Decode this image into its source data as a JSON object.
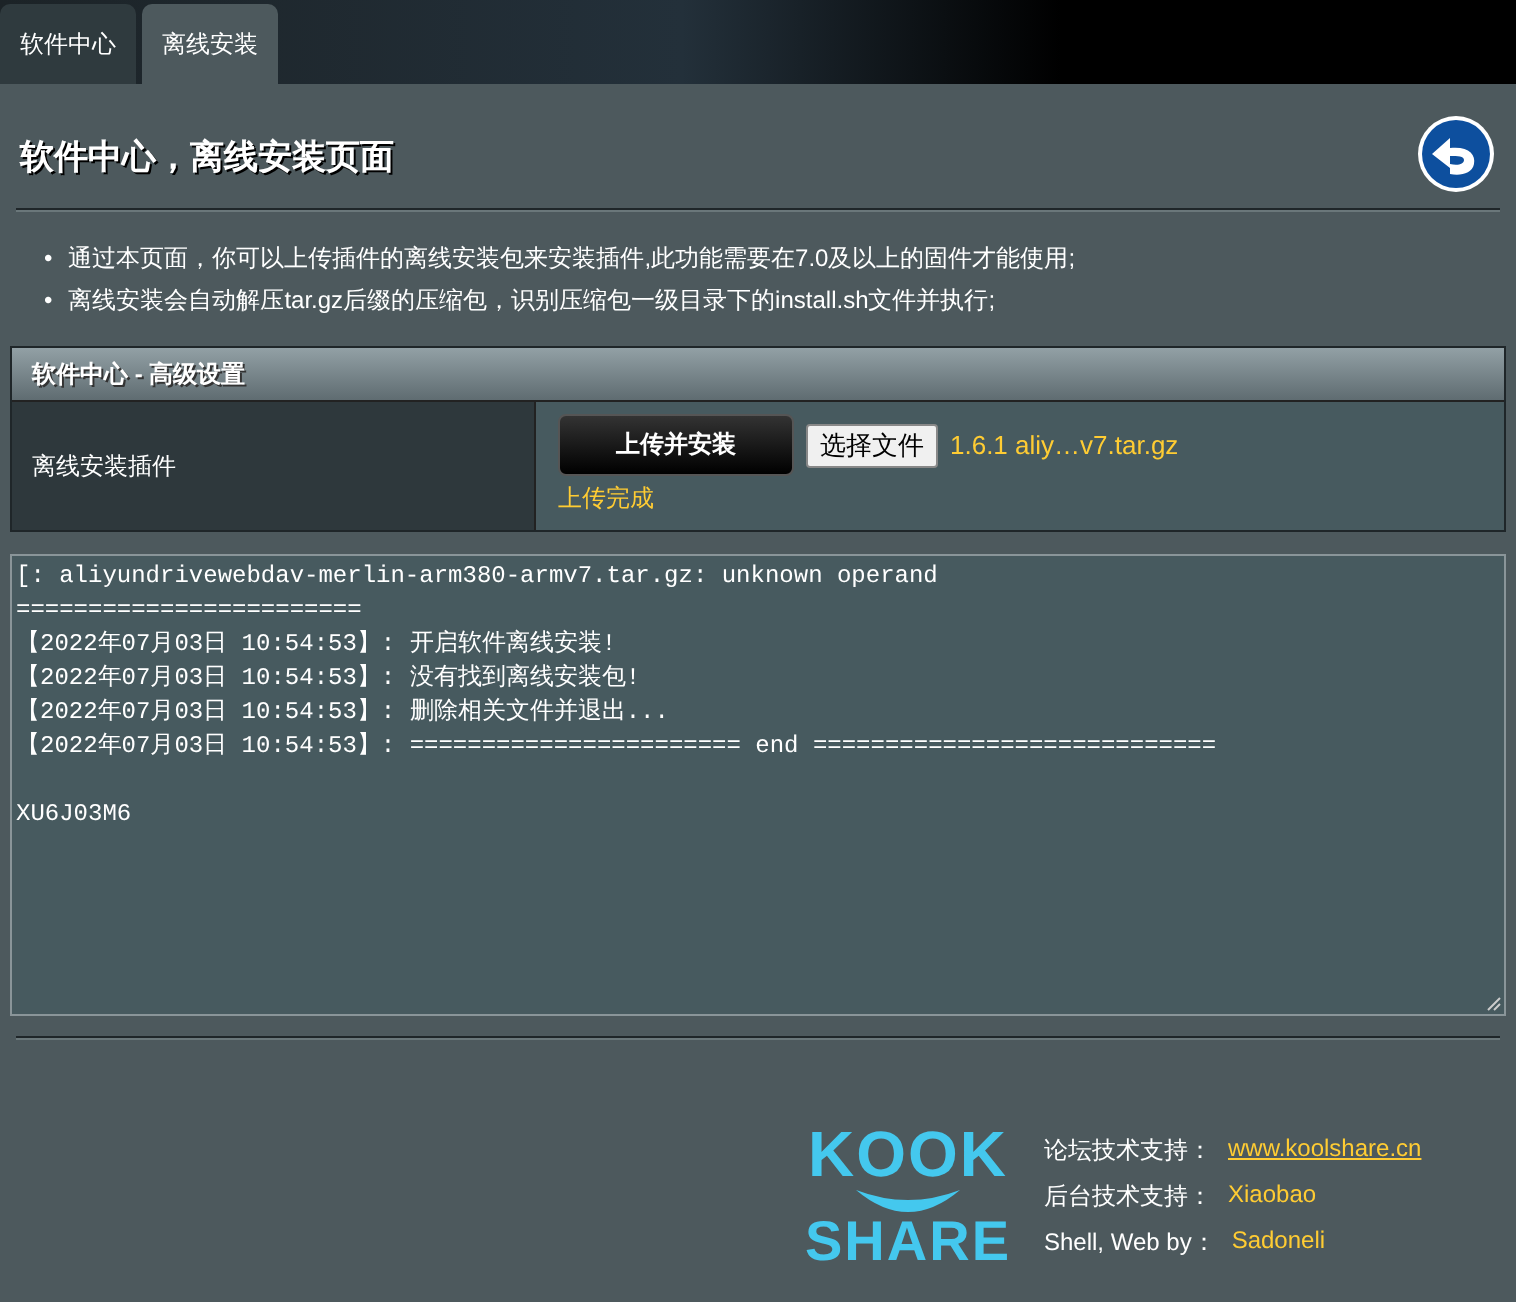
{
  "tabs": [
    {
      "label": "软件中心",
      "selected": false
    },
    {
      "label": "离线安装",
      "selected": true
    }
  ],
  "page": {
    "title": "软件中心，离线安装页面"
  },
  "notes": [
    {
      "marker": "•",
      "text": "通过本页面，你可以上传插件的离线安装包来安装插件,此功能需要在7.0及以上的固件才能使用;"
    },
    {
      "marker": "•",
      "text": "离线安装会自动解压tar.gz后缀的压缩包，识别压缩包一级目录下的install.sh文件并执行;"
    }
  ],
  "settings": {
    "header": "软件中心 - 高级设置",
    "label": "离线安装插件",
    "upload_button": "上传并安装",
    "file_button": "选择文件",
    "file_name": "1.6.1 aliy…v7.tar.gz",
    "status": "上传完成"
  },
  "log": {
    "lines": [
      "[: aliyundrivewebdav-merlin-arm380-armv7.tar.gz: unknown operand",
      "========================",
      "【2022年07月03日 10:54:53】: 开启软件离线安装!",
      "【2022年07月03日 10:54:53】: 没有找到离线安装包!",
      "【2022年07月03日 10:54:53】: 删除相关文件并退出...",
      "【2022年07月03日 10:54:53】: ======================= end ============================"
    ],
    "code": "XU6J03M6"
  },
  "footer": {
    "logo": {
      "line_1": "KOOK",
      "line_2": "SHARE"
    },
    "credits": [
      {
        "label": "论坛技术支持：",
        "value": "www.koolshare.cn",
        "kind": "link"
      },
      {
        "label": "后台技术支持：",
        "value": "Xiaobao",
        "kind": "text"
      },
      {
        "label": "Shell, Web by：",
        "value": "Sadoneli",
        "kind": "text"
      }
    ]
  }
}
